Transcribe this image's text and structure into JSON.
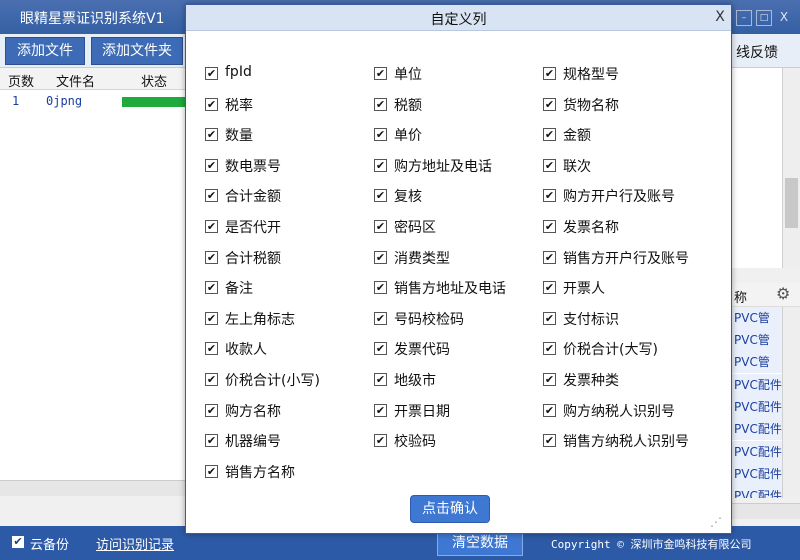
{
  "app": {
    "title": "眼精星票证识别系统V1",
    "add_file": "添加文件",
    "add_folder": "添加文件夹",
    "feedback": "线反馈",
    "minimize": "–",
    "maximize": "□",
    "close": "X"
  },
  "file_table": {
    "headers": [
      "页数",
      "文件名",
      "状态"
    ],
    "rows": [
      {
        "page": "1",
        "name": "0jpng",
        "status_progress": 1.0
      }
    ]
  },
  "right_list": {
    "column": "称",
    "items": [
      "PVC管",
      "PVC管",
      "PVC管",
      "PVC配件",
      "PVC配件",
      "PVC配件",
      "PVC配件",
      "PVC配件",
      "PVC配件"
    ]
  },
  "statusbar": {
    "cloud_backup": "云备份",
    "cloud_backup_checked": true,
    "history_link": "访问识别记录",
    "clear": "清空数据",
    "copyright": "Copyright © 深圳市金鸣科技有限公司"
  },
  "dialog": {
    "title": "自定义列",
    "close": "X",
    "confirm": "点击确认",
    "columns": [
      [
        "fpId",
        "税率",
        "数量",
        "数电票号",
        "合计金额",
        "是否代开",
        "合计税额",
        "备注",
        "左上角标志",
        "收款人",
        "价税合计(小写)",
        "购方名称",
        "机器编号",
        "销售方名称"
      ],
      [
        "单位",
        "税额",
        "单价",
        "购方地址及电话",
        "复核",
        "密码区",
        "消费类型",
        "销售方地址及电话",
        "号码校检码",
        "发票代码",
        "地级市",
        "开票日期",
        "校验码"
      ],
      [
        "规格型号",
        "货物名称",
        "金额",
        "联次",
        "购方开户行及账号",
        "发票名称",
        "销售方开户行及账号",
        "开票人",
        "支付标识",
        "价税合计(大写)",
        "发票种类",
        "购方纳税人识别号",
        "销售方纳税人识别号"
      ]
    ]
  }
}
